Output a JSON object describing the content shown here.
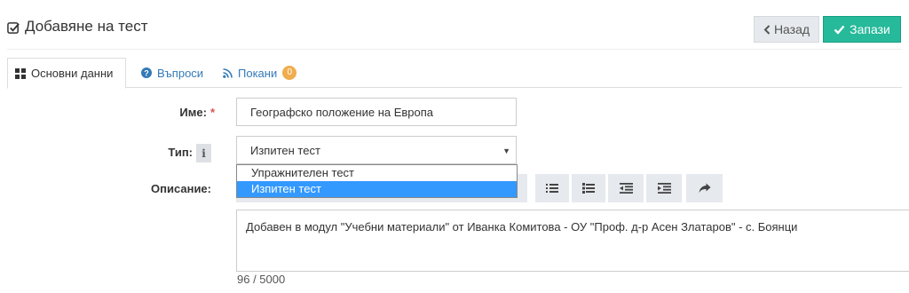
{
  "header": {
    "title": "Добавяне на тест",
    "title_icon": "check-square-icon",
    "back_label": "Назад",
    "save_label": "Запази"
  },
  "tabs": [
    {
      "label": "Основни данни",
      "icon": "grid-icon",
      "active": true
    },
    {
      "label": "Въпроси",
      "icon": "question-circle-icon",
      "active": false
    },
    {
      "label": "Покани",
      "icon": "rss-icon",
      "active": false,
      "badge": "0"
    }
  ],
  "form": {
    "name_label": "Име:",
    "name_required": "*",
    "name_value": "Географско положение на Европа",
    "type_label": "Тип:",
    "type_info_icon": "i",
    "type_value": "Изпитен тест",
    "type_options": [
      "Упражнителен тест",
      "Изпитен тест"
    ],
    "description_label": "Описание:",
    "description_value": "Добавен в модул \"Учебни материали\" от Иванка Комитова - ОУ \"Проф. д-р Асен Златаров\" - с. Боянци",
    "counter": "96 / 5000"
  },
  "colors": {
    "save": "#26b99a",
    "link": "#337ab7",
    "badge": "#f0ad4e",
    "selected_option": "#3399ff"
  }
}
